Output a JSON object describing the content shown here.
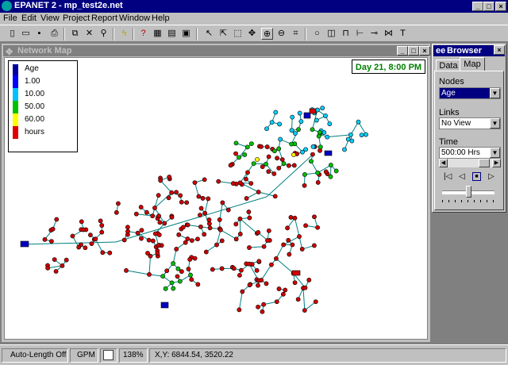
{
  "app": {
    "title": "EPANET 2 - mp_test2e.net"
  },
  "menu": [
    "File",
    "Edit",
    "View",
    "Project",
    "Report",
    "Window",
    "Help"
  ],
  "toolbar": {
    "icons": [
      "new-icon",
      "open-icon",
      "save-icon",
      "print-icon",
      "copy-icon",
      "delete-icon",
      "find-icon",
      "run-icon",
      "query-icon",
      "graph-icon",
      "table-icon",
      "options-icon",
      "select-icon",
      "vertex-icon",
      "region-icon",
      "pan-icon",
      "zoom-in-icon",
      "zoom-out-icon",
      "full-extent-icon",
      "junction-icon",
      "reservoir-icon",
      "tank-icon",
      "pipe-icon",
      "pump-icon",
      "valve-icon",
      "label-icon"
    ]
  },
  "map": {
    "title": "Network Map",
    "timestamp": "Day 21, 8:00 PM",
    "legend": {
      "title": "Age",
      "items": [
        {
          "label": "1.00",
          "color": "#0000ff"
        },
        {
          "label": "10.00",
          "color": "#00c0ff"
        },
        {
          "label": "50.00",
          "color": "#00c000"
        },
        {
          "label": "60.00",
          "color": "#ffff00"
        },
        {
          "label": "hours",
          "color": "#e00000"
        }
      ],
      "top_color": "#0000a0"
    }
  },
  "browser": {
    "title": "Browser",
    "tabs": [
      "Data",
      "Map"
    ],
    "active_tab": "Map",
    "nodes_label": "Nodes",
    "nodes_value": "Age",
    "links_label": "Links",
    "links_value": "No View",
    "time_label": "Time",
    "time_value": "500:00 Hrs"
  },
  "status": {
    "auto_length": "Auto-Length Off",
    "flow_units": "GPM",
    "zoom": "138%",
    "xy": "X,Y: 6844.54, 3520.22"
  },
  "colors": {
    "node_red": "#d00000",
    "node_green": "#00c000",
    "node_cyan": "#00d0ff",
    "node_yellow": "#ffff00",
    "link_color": "#008080"
  }
}
